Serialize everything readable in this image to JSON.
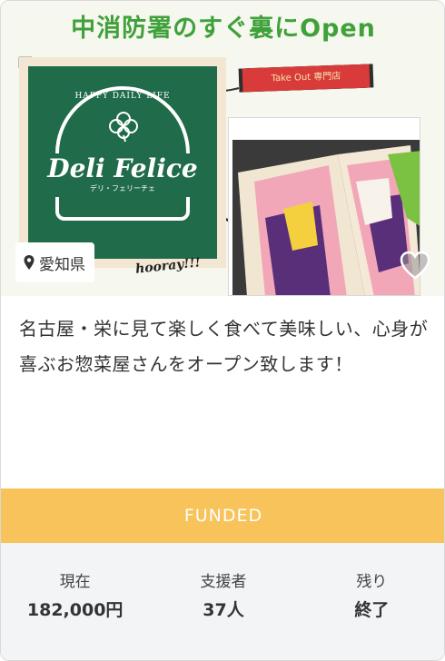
{
  "hero": {
    "title": "中消防署のすぐ裏にOpen",
    "takeout_tag": "Take Out 専門店",
    "logo_arc": "HAPPY DAILY LIFE",
    "logo_name": "Deli Felice",
    "logo_kana": "デリ・フェリーチェ",
    "handwritten": "hooray!!!",
    "location": "愛知県"
  },
  "description": "名古屋・栄に見て楽しく食べて美味しい、心身が喜ぶお惣菜屋さんをオープン致します！",
  "status": {
    "label": "FUNDED",
    "color": "#f7c35a"
  },
  "stats": [
    {
      "label": "現在",
      "value": "182,000円"
    },
    {
      "label": "支援者",
      "value": "37人"
    },
    {
      "label": "残り",
      "value": "終了"
    }
  ],
  "colors": {
    "title_green": "#3fa13a",
    "logo_green": "#1f6b4a",
    "stats_bg": "#f2f4f6"
  }
}
